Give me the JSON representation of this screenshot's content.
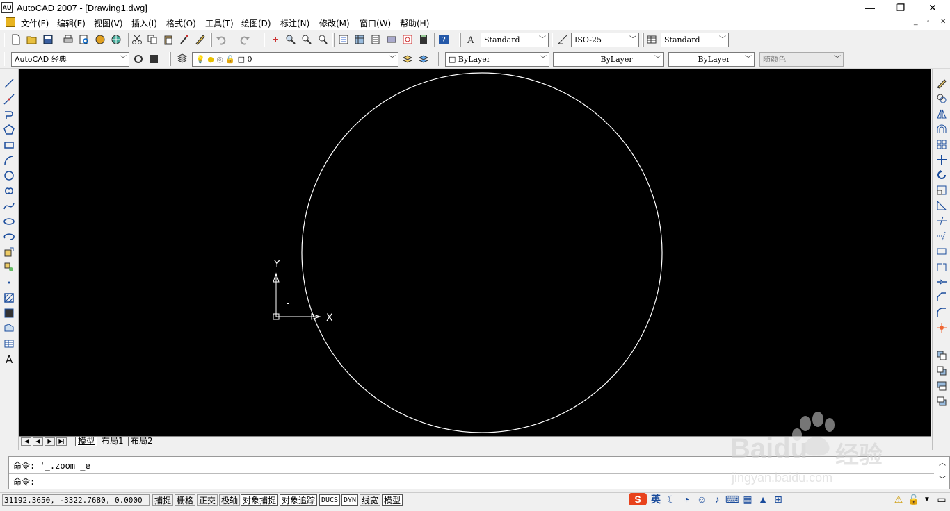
{
  "window": {
    "title": "AutoCAD 2007 - [Drawing1.dwg]",
    "app_icon_text": "AU",
    "controls": {
      "minimize": "—",
      "maximize": "❐",
      "close": "✕"
    }
  },
  "menubar": {
    "items": [
      "文件(F)",
      "编辑(E)",
      "视图(V)",
      "插入(I)",
      "格式(O)",
      "工具(T)",
      "绘图(D)",
      "标注(N)",
      "修改(M)",
      "窗口(W)",
      "帮助(H)"
    ],
    "mdi": {
      "minimize": "_",
      "restore": "▫",
      "close": "✕"
    }
  },
  "toolbar1": {
    "text_style": "Standard",
    "dim_style": "ISO-25",
    "table_style": "Standard"
  },
  "toolbar2": {
    "workspace": "AutoCAD 经典",
    "layer": "0",
    "color": "ByLayer",
    "linetype": "ByLayer",
    "lineweight": "ByLayer",
    "plotstyle": "随颜色"
  },
  "ucs": {
    "y_label": "Y",
    "x_label": "X"
  },
  "layout_tabs": {
    "tabs": [
      "模型",
      "布局1",
      "布局2"
    ],
    "active": "模型",
    "nav": [
      "|◀",
      "◀",
      "▶",
      "▶|"
    ]
  },
  "command": {
    "history": "命令: '_.zoom _e",
    "prompt": "命令:"
  },
  "status": {
    "coordinates": "31192.3650, -3322.7680, 0.0000",
    "toggles": [
      "捕捉",
      "栅格",
      "正交",
      "极轴",
      "对象捕捉",
      "对象追踪",
      "DUCS",
      "DYN",
      "线宽",
      "模型"
    ],
    "tray": {
      "ime_label": "英"
    }
  },
  "watermark": {
    "brand": "Baidu",
    "brand_cn": "经验",
    "url": "jingyan.baidu.com"
  },
  "colors": {
    "canvas": "#000000",
    "circle": "#ffffff",
    "chrome": "#f0f0f0"
  }
}
